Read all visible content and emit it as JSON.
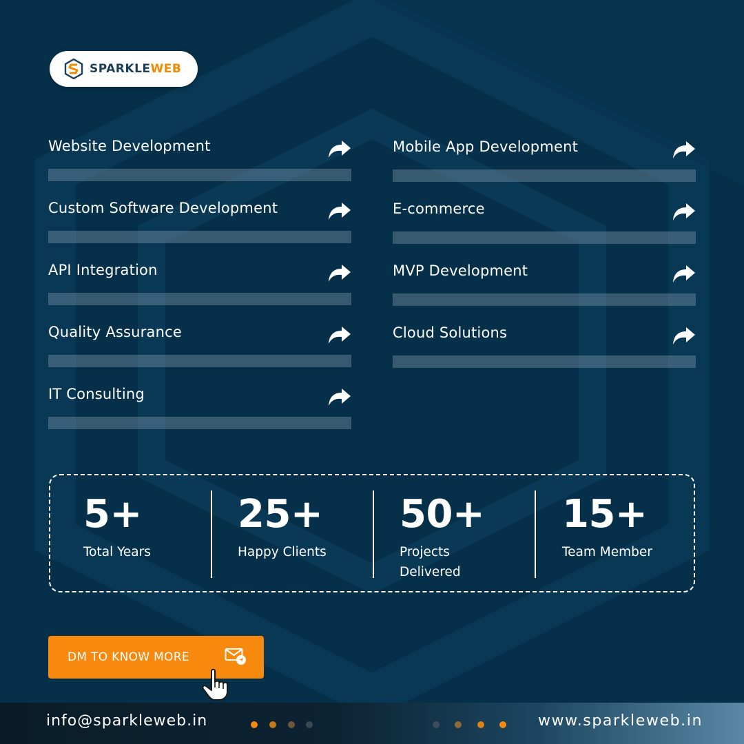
{
  "brand": {
    "logo_part1": "SPARKLE",
    "logo_part2": "WEB",
    "accent_color": "#f7890f",
    "background_color": "#06304a"
  },
  "services": {
    "left": [
      {
        "label": "Website Development"
      },
      {
        "label": "Custom Software Development"
      },
      {
        "label": "API Integration"
      },
      {
        "label": "Quality Assurance"
      },
      {
        "label": "IT Consulting"
      }
    ],
    "right": [
      {
        "label": "Mobile App Development"
      },
      {
        "label": "E-commerce"
      },
      {
        "label": "MVP Development"
      },
      {
        "label": "Cloud Solutions"
      }
    ],
    "arrow_icon": "share-arrow-icon"
  },
  "stats": [
    {
      "value": "5+",
      "label": "Total Years"
    },
    {
      "value": "25+",
      "label": "Happy Clients"
    },
    {
      "value": "50+",
      "label": "Projects Delivered"
    },
    {
      "value": "15+",
      "label": "Team Member"
    }
  ],
  "cta": {
    "label": "DM TO KNOW MORE",
    "icons": [
      "mail-icon",
      "pointer-hand-icon"
    ]
  },
  "footer": {
    "email": "info@sparkleweb.in",
    "website": "www.sparkleweb.in"
  }
}
